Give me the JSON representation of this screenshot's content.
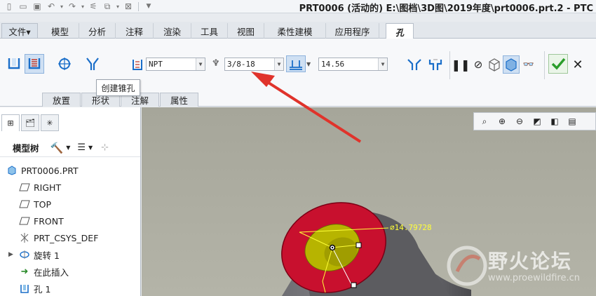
{
  "titlebar": {
    "title": "PRT0006 (活动的) E:\\图档\\3D图\\2019年度\\prt0006.prt.2 - PTC"
  },
  "tabs": [
    {
      "label": "文件▾",
      "type": "file"
    },
    {
      "label": "模型"
    },
    {
      "label": "分析"
    },
    {
      "label": "注释"
    },
    {
      "label": "渲染"
    },
    {
      "label": "工具"
    },
    {
      "label": "视图"
    },
    {
      "label": "柔性建模"
    },
    {
      "label": "应用程序"
    },
    {
      "label": "孔",
      "type": "active"
    }
  ],
  "ribbon": {
    "standard_combo": "NPT",
    "size_combo": "3/8-18",
    "depth_combo": "14.56",
    "subtabs": [
      "放置",
      "形状",
      "注解",
      "属性"
    ],
    "tooltip": "创建锥孔"
  },
  "panel": {
    "tree_title": "模型树",
    "items": [
      {
        "label": "PRT0006.PRT",
        "icon": "part-icon",
        "indent": 0
      },
      {
        "label": "RIGHT",
        "icon": "datum-plane-icon",
        "indent": 1
      },
      {
        "label": "TOP",
        "icon": "datum-plane-icon",
        "indent": 1
      },
      {
        "label": "FRONT",
        "icon": "datum-plane-icon",
        "indent": 1
      },
      {
        "label": "PRT_CSYS_DEF",
        "icon": "csys-icon",
        "indent": 1
      },
      {
        "label": "旋转 1",
        "icon": "revolve-icon",
        "indent": 1,
        "expandable": true
      },
      {
        "label": "在此插入",
        "icon": "insert-here-icon",
        "indent": 1
      },
      {
        "label": "孔 1",
        "icon": "hole-feature-icon",
        "indent": 1
      }
    ]
  },
  "viewport": {
    "dimension": "14.79728",
    "watermark_cn": "野火论坛",
    "watermark_url": "www.proewildfire.cn"
  },
  "colors": {
    "accent": "#1a6ec9",
    "cylinder_face": "#c8102e",
    "hole_inner": "#b7b400",
    "confirm": "#2a9d2a",
    "arrow": "#e0332b"
  }
}
